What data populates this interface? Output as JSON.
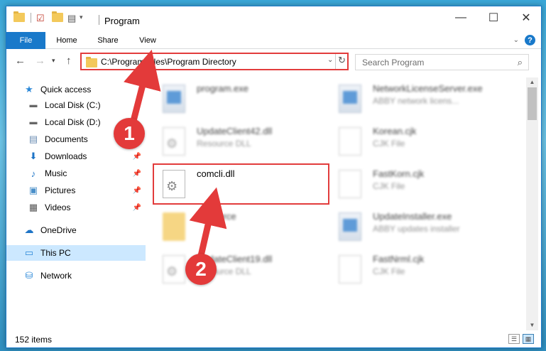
{
  "window": {
    "title": "Program",
    "qat_dropdown": "▾"
  },
  "ribbon": {
    "tabs": [
      "File",
      "Home",
      "Share",
      "View"
    ],
    "help": "?"
  },
  "nav": {
    "back": "←",
    "forward": "→",
    "history": "▾",
    "up": "↑",
    "address": "C:\\Program Files\\Program Directory",
    "search_placeholder": "Search Program"
  },
  "sidebar": {
    "items": [
      {
        "label": "Quick access",
        "icon": "star-icon",
        "pinned": false
      },
      {
        "label": "Local Disk (C:)",
        "icon": "drive-icon",
        "pinned": false
      },
      {
        "label": "Local Disk (D:)",
        "icon": "drive-icon",
        "pinned": false
      },
      {
        "label": "Documents",
        "icon": "documents-icon",
        "pinned": false
      },
      {
        "label": "Downloads",
        "icon": "download-icon",
        "pinned": true
      },
      {
        "label": "Music",
        "icon": "music-icon",
        "pinned": true
      },
      {
        "label": "Pictures",
        "icon": "pictures-icon",
        "pinned": true
      },
      {
        "label": "Videos",
        "icon": "videos-icon",
        "pinned": true
      },
      {
        "label": "OneDrive",
        "icon": "onedrive-icon",
        "pinned": false
      },
      {
        "label": "This PC",
        "icon": "pc-icon",
        "pinned": false,
        "selected": true
      },
      {
        "label": "Network",
        "icon": "network-icon",
        "pinned": false
      }
    ]
  },
  "files": [
    {
      "name": "program.exe",
      "type": "",
      "icon": "exe-icon",
      "blurred": true
    },
    {
      "name": "NetworkLicenseServer.exe",
      "type": "ABBY network licens...",
      "icon": "exe-icon",
      "blurred": true
    },
    {
      "name": "UpdateClient42.dll",
      "type": "Resource DLL",
      "icon": "dll-icon",
      "blurred": true
    },
    {
      "name": "Korean.cjk",
      "type": "CJK File",
      "icon": "document-icon",
      "blurred": true
    },
    {
      "name": "comcli.dll",
      "type": "",
      "icon": "dll-icon",
      "blurred": false
    },
    {
      "name": "FastKorn.cjk",
      "type": "CJK File",
      "icon": "document-icon",
      "blurred": true
    },
    {
      "name": "Resource",
      "type": "",
      "icon": "folder-icon",
      "blurred": true
    },
    {
      "name": "UpdateInstaller.exe",
      "type": "ABBY updates installer",
      "icon": "exe-icon",
      "blurred": true
    },
    {
      "name": "UpdateClient19.dll",
      "type": "Resource DLL",
      "icon": "dll-icon",
      "blurred": true
    },
    {
      "name": "FastNrml.cjk",
      "type": "CJK File",
      "icon": "document-icon",
      "blurred": true
    }
  ],
  "status": {
    "item_count": "152 items"
  },
  "annotations": {
    "step1": "1",
    "step2": "2",
    "color": "#e33a3a"
  }
}
